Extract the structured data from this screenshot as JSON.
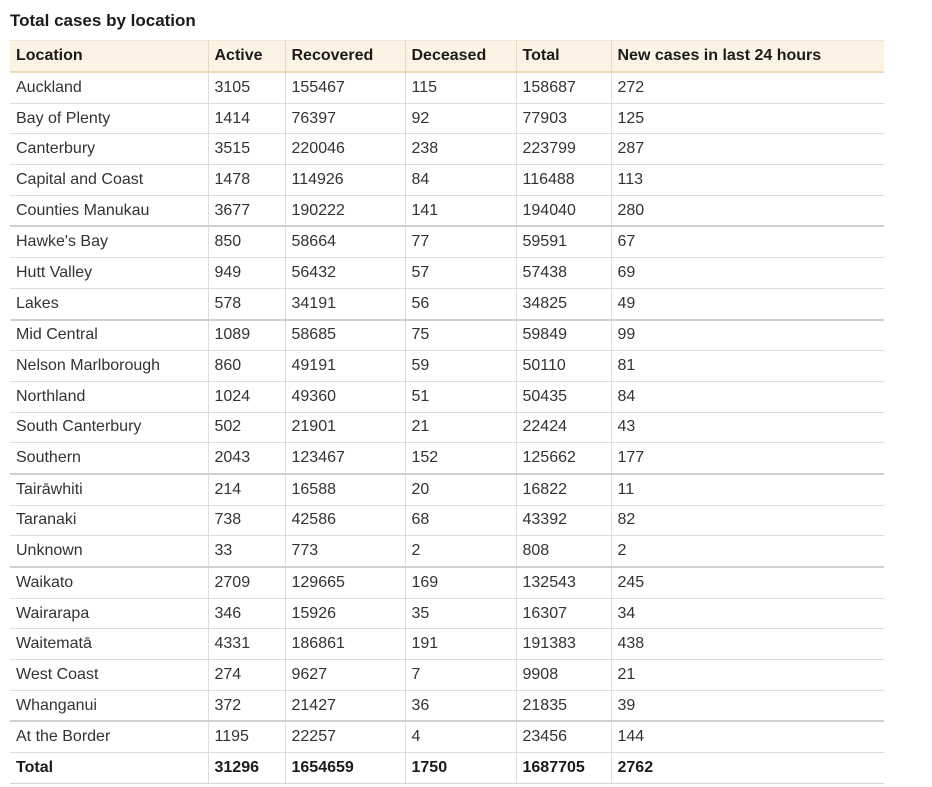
{
  "table": {
    "title": "Total cases by location",
    "headers": {
      "location": "Location",
      "active": "Active",
      "recovered": "Recovered",
      "deceased": "Deceased",
      "total": "Total",
      "new_cases": "New cases in last 24 hours"
    },
    "rows": [
      [
        "Auckland",
        "3105",
        "155467",
        "115",
        "158687",
        "272"
      ],
      [
        "Bay of Plenty",
        "1414",
        "76397",
        "92",
        "77903",
        "125"
      ],
      [
        "Canterbury",
        "3515",
        "220046",
        "238",
        "223799",
        "287"
      ],
      [
        "Capital and Coast",
        "1478",
        "114926",
        "84",
        "116488",
        "113"
      ],
      [
        "Counties Manukau",
        "3677",
        "190222",
        "141",
        "194040",
        "280"
      ],
      [
        "Hawke's Bay",
        "850",
        "58664",
        "77",
        "59591",
        "67"
      ],
      [
        "Hutt Valley",
        "949",
        "56432",
        "57",
        "57438",
        "69"
      ],
      [
        "Lakes",
        "578",
        "34191",
        "56",
        "34825",
        "49"
      ],
      [
        "Mid Central",
        "1089",
        "58685",
        "75",
        "59849",
        "99"
      ],
      [
        "Nelson Marlborough",
        "860",
        "49191",
        "59",
        "50110",
        "81"
      ],
      [
        "Northland",
        "1024",
        "49360",
        "51",
        "50435",
        "84"
      ],
      [
        "South Canterbury",
        "502",
        "21901",
        "21",
        "22424",
        "43"
      ],
      [
        "Southern",
        "2043",
        "123467",
        "152",
        "125662",
        "177"
      ],
      [
        "Tairāwhiti",
        "214",
        "16588",
        "20",
        "16822",
        "11"
      ],
      [
        "Taranaki",
        "738",
        "42586",
        "68",
        "43392",
        "82"
      ],
      [
        "Unknown",
        "33",
        "773",
        "2",
        "808",
        "2"
      ],
      [
        "Waikato",
        "2709",
        "129665",
        "169",
        "132543",
        "245"
      ],
      [
        "Wairarapa",
        "346",
        "15926",
        "35",
        "16307",
        "34"
      ],
      [
        "Waitematā",
        "4331",
        "186861",
        "191",
        "191383",
        "438"
      ],
      [
        "West Coast",
        "274",
        "9627",
        "7",
        "9908",
        "21"
      ],
      [
        "Whanganui",
        "372",
        "21427",
        "36",
        "21835",
        "39"
      ],
      [
        "At the Border",
        "1195",
        "22257",
        "4",
        "23456",
        "144"
      ]
    ],
    "total_row": [
      "Total",
      "31296",
      "1654659",
      "1750",
      "1687705",
      "2762"
    ]
  },
  "colors": {
    "header_background": "#fdf3e5",
    "header_border": "#f1d9b6",
    "row_border": "#dedede"
  }
}
